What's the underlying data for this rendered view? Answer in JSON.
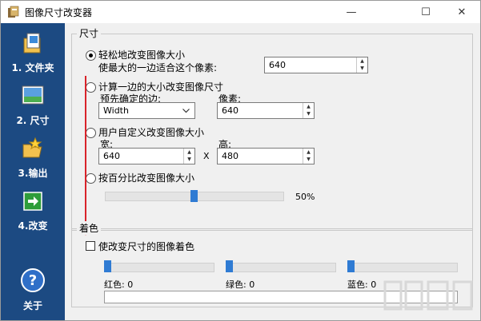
{
  "window": {
    "title": "图像尺寸改变器",
    "min_label": "—",
    "max_label": "☐",
    "close_label": "✕"
  },
  "sidebar": {
    "items": [
      {
        "label": "1. 文件夹",
        "icon": "folder-documents-icon"
      },
      {
        "label": "2. 尺寸",
        "icon": "landscape-picture-icon"
      },
      {
        "label": "3.输出",
        "icon": "open-folder-star-icon"
      },
      {
        "label": "4.改变",
        "icon": "green-arrow-icon"
      }
    ],
    "about": {
      "label": "关于",
      "icon": "help-question-icon"
    }
  },
  "size_group": {
    "title": "尺寸",
    "option_easy": {
      "label": "轻松地改变图像大小",
      "sublabel": "使最大的一边适合这个像素:",
      "value": "640",
      "selected": true
    },
    "option_one_side": {
      "label": "计算一边的大小改变图像尺寸",
      "side_label": "预先确定的边:",
      "side_value": "Width",
      "pixel_label": "像素:",
      "pixel_value": "640",
      "selected": false
    },
    "option_custom": {
      "label": "用户自定义改变图像大小",
      "width_label": "宽:",
      "width_value": "640",
      "x_label": "X",
      "height_label": "高:",
      "height_value": "480",
      "selected": false
    },
    "option_percent": {
      "label": "按百分比改变图像大小",
      "value_label": "50%",
      "value": 0.5,
      "selected": false
    }
  },
  "color_group": {
    "title": "着色",
    "checkbox_label": "使改变尺寸的图像着色",
    "checked": false,
    "red_label": "红色: 0",
    "green_label": "绿色: 0",
    "blue_label": "蓝色: 0"
  },
  "colors": {
    "sidebar_bg": "#1c4a82",
    "slider_thumb": "#2f7bd3",
    "annotation_arrow": "#d9232a"
  }
}
